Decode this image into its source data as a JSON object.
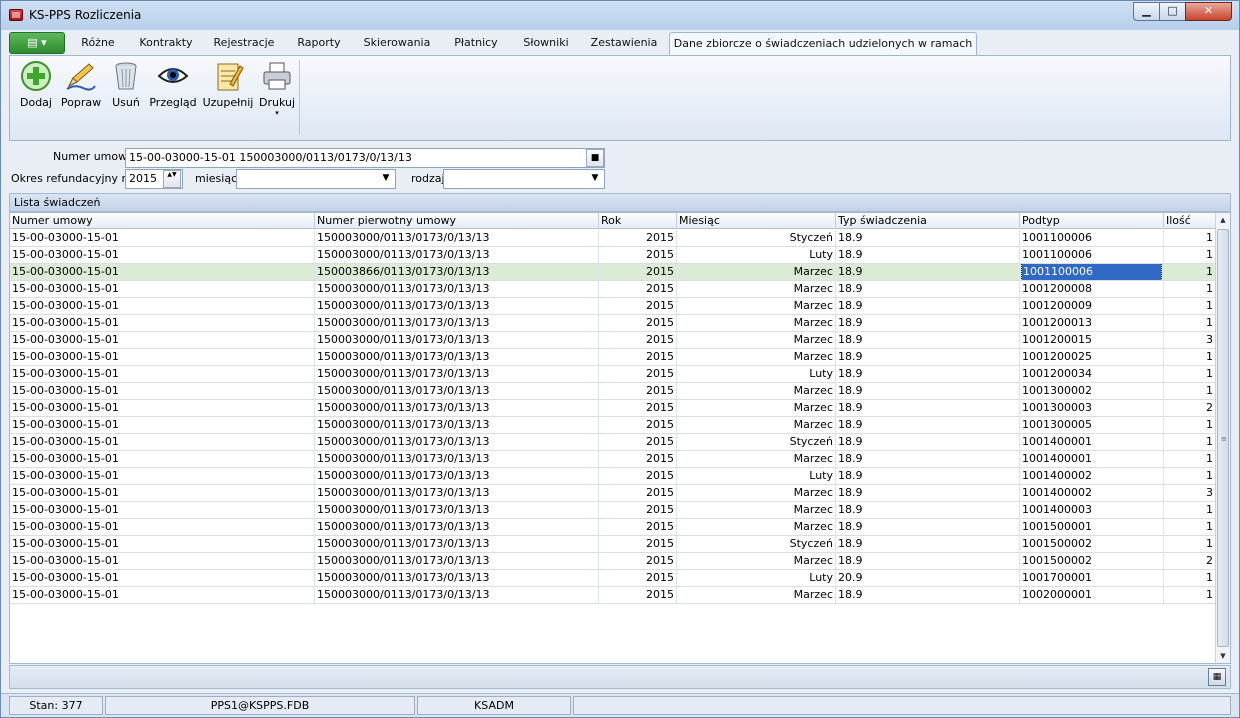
{
  "window": {
    "title": "KS-PPS Rozliczenia",
    "min_glyph": "▁",
    "max_glyph": "□",
    "close_glyph": "✕"
  },
  "ribbon_tabs": {
    "app_menu_glyph": "▤ ▾",
    "items": [
      "Różne",
      "Kontrakty",
      "Rejestracje",
      "Raporty",
      "Skierowania",
      "Płatnicy",
      "Słowniki",
      "Zestawienia",
      "Dane zbiorcze o świadczeniach udzielonych w ramach POZ"
    ],
    "active_index": 8
  },
  "toolbar": {
    "buttons": [
      {
        "label": "Dodaj",
        "icon": "add-icon"
      },
      {
        "label": "Popraw",
        "icon": "edit-pen-icon"
      },
      {
        "label": "Usuń",
        "icon": "trash-icon"
      },
      {
        "label": "Przegląd",
        "icon": "eye-icon"
      },
      {
        "label": "Uzupełnij",
        "icon": "notepad-icon"
      },
      {
        "label": "Drukuj",
        "icon": "printer-icon",
        "dropdown_glyph": "▾"
      }
    ]
  },
  "filter": {
    "contract_label": "Numer umowy:",
    "contract_value": "15-00-03000-15-01 150003000/0113/0173/0/13/13",
    "contract_button_glyph": "■",
    "period_label": "Okres refundacyjny rok:",
    "year_value": "2015",
    "spin_glyph": "▲▼",
    "month_label": "miesiąc:",
    "month_value": "",
    "type_label": "rodzaj:",
    "type_value": "",
    "dropdown_glyph": "▼"
  },
  "grid": {
    "group_title": "Lista świadczeń",
    "columns": [
      "Numer umowy",
      "Numer pierwotny umowy",
      "Rok",
      "Miesiąc",
      "Typ świadczenia",
      "Podtyp",
      "Ilość"
    ],
    "selected_row": 2,
    "rows": [
      [
        "15-00-03000-15-01",
        "150003000/0113/0173/0/13/13",
        "2015",
        "Styczeń",
        "18.9",
        "1001100006",
        "1"
      ],
      [
        "15-00-03000-15-01",
        "150003000/0113/0173/0/13/13",
        "2015",
        "Luty",
        "18.9",
        "1001100006",
        "1"
      ],
      [
        "15-00-03000-15-01",
        "150003866/0113/0173/0/13/13",
        "2015",
        "Marzec",
        "18.9",
        "1001100006",
        "1"
      ],
      [
        "15-00-03000-15-01",
        "150003000/0113/0173/0/13/13",
        "2015",
        "Marzec",
        "18.9",
        "1001200008",
        "1"
      ],
      [
        "15-00-03000-15-01",
        "150003000/0113/0173/0/13/13",
        "2015",
        "Marzec",
        "18.9",
        "1001200009",
        "1"
      ],
      [
        "15-00-03000-15-01",
        "150003000/0113/0173/0/13/13",
        "2015",
        "Marzec",
        "18.9",
        "1001200013",
        "1"
      ],
      [
        "15-00-03000-15-01",
        "150003000/0113/0173/0/13/13",
        "2015",
        "Marzec",
        "18.9",
        "1001200015",
        "3"
      ],
      [
        "15-00-03000-15-01",
        "150003000/0113/0173/0/13/13",
        "2015",
        "Marzec",
        "18.9",
        "1001200025",
        "1"
      ],
      [
        "15-00-03000-15-01",
        "150003000/0113/0173/0/13/13",
        "2015",
        "Luty",
        "18.9",
        "1001200034",
        "1"
      ],
      [
        "15-00-03000-15-01",
        "150003000/0113/0173/0/13/13",
        "2015",
        "Marzec",
        "18.9",
        "1001300002",
        "1"
      ],
      [
        "15-00-03000-15-01",
        "150003000/0113/0173/0/13/13",
        "2015",
        "Marzec",
        "18.9",
        "1001300003",
        "2"
      ],
      [
        "15-00-03000-15-01",
        "150003000/0113/0173/0/13/13",
        "2015",
        "Marzec",
        "18.9",
        "1001300005",
        "1"
      ],
      [
        "15-00-03000-15-01",
        "150003000/0113/0173/0/13/13",
        "2015",
        "Styczeń",
        "18.9",
        "1001400001",
        "1"
      ],
      [
        "15-00-03000-15-01",
        "150003000/0113/0173/0/13/13",
        "2015",
        "Marzec",
        "18.9",
        "1001400001",
        "1"
      ],
      [
        "15-00-03000-15-01",
        "150003000/0113/0173/0/13/13",
        "2015",
        "Luty",
        "18.9",
        "1001400002",
        "1"
      ],
      [
        "15-00-03000-15-01",
        "150003000/0113/0173/0/13/13",
        "2015",
        "Marzec",
        "18.9",
        "1001400002",
        "3"
      ],
      [
        "15-00-03000-15-01",
        "150003000/0113/0173/0/13/13",
        "2015",
        "Marzec",
        "18.9",
        "1001400003",
        "1"
      ],
      [
        "15-00-03000-15-01",
        "150003000/0113/0173/0/13/13",
        "2015",
        "Marzec",
        "18.9",
        "1001500001",
        "1"
      ],
      [
        "15-00-03000-15-01",
        "150003000/0113/0173/0/13/13",
        "2015",
        "Styczeń",
        "18.9",
        "1001500002",
        "1"
      ],
      [
        "15-00-03000-15-01",
        "150003000/0113/0173/0/13/13",
        "2015",
        "Marzec",
        "18.9",
        "1001500002",
        "2"
      ],
      [
        "15-00-03000-15-01",
        "150003000/0113/0173/0/13/13",
        "2015",
        "Luty",
        "20.9",
        "1001700001",
        "1"
      ],
      [
        "15-00-03000-15-01",
        "150003000/0113/0173/0/13/13",
        "2015",
        "Marzec",
        "18.9",
        "1002000001",
        "1"
      ]
    ],
    "scroll_up_glyph": "▲",
    "scroll_down_glyph": "▼",
    "grip_glyph": "≡"
  },
  "footer": {
    "calc_glyph": "▦"
  },
  "statusbar": {
    "status": "Stan: 377",
    "database": "PPS1@KSPPS.FDB",
    "user": "KSADM",
    "extra": ""
  }
}
